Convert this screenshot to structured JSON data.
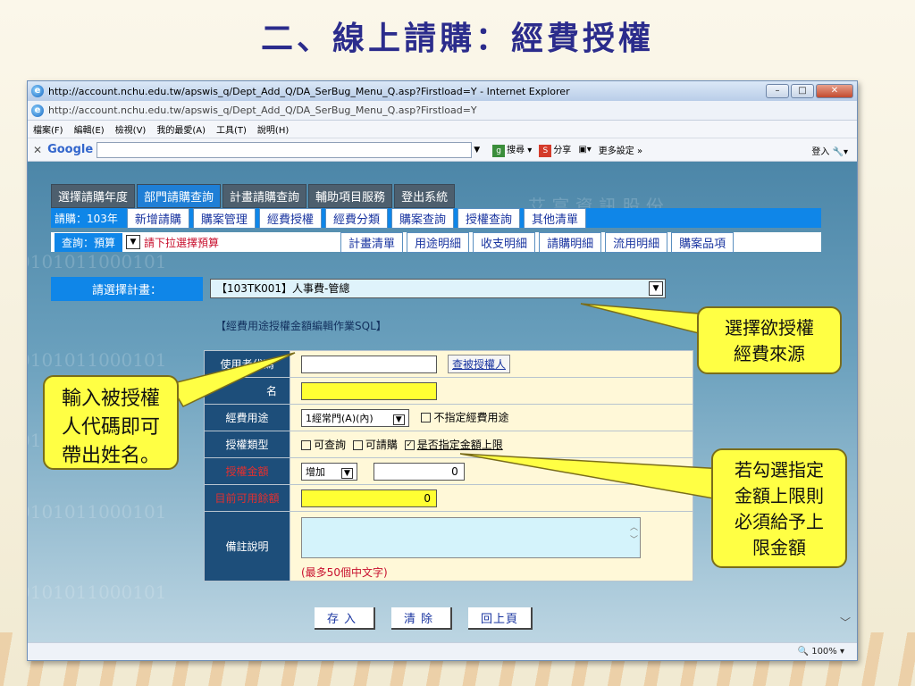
{
  "slide": {
    "title": "二、線上請購：經費授權"
  },
  "window": {
    "title": "http://account.nchu.edu.tw/apswis_q/Dept_Add_Q/DA_SerBug_Menu_Q.asp?Firstload=Y - Internet Explorer",
    "address": "http://account.nchu.edu.tw/apswis_q/Dept_Add_Q/DA_SerBug_Menu_Q.asp?Firstload=Y",
    "menu": [
      "檔案(F)",
      "編輯(E)",
      "檢視(V)",
      "我的最愛(A)",
      "工具(T)",
      "說明(H)"
    ],
    "google": {
      "logo": "Google",
      "search": "搜尋",
      "share": "分享",
      "more": "更多設定 »",
      "login": "登入"
    },
    "zoom": "100%"
  },
  "nav_tabs": [
    "選擇請購年度",
    "部門請購查詢",
    "計畫請購查詢",
    "輔助項目服務",
    "登出系統"
  ],
  "row2": {
    "label": "請購：103年",
    "buttons": [
      "新增請購",
      "購案管理",
      "經費授權",
      "經費分類",
      "購案查詢",
      "授權查詢",
      "其他清單"
    ]
  },
  "row3": {
    "label": "查詢：預算",
    "hint": "請下拉選擇預算",
    "buttons": [
      "計畫清單",
      "用途明細",
      "收支明細",
      "請購明細",
      "流用明細",
      "購案品項"
    ]
  },
  "plan": {
    "label": "請選擇計畫：",
    "value": "【103TK001】人事費-管總"
  },
  "form": {
    "legend": "【經費用途授權金額編輯作業SQL】",
    "user_code_label": "使用者代碼",
    "find_link": "查被授權人",
    "name_label": "名",
    "purpose_label": "經費用途",
    "purpose_value": "1經常門(A)(內)",
    "purpose_unspecified": "不指定經費用途",
    "auth_type_label": "授權類型",
    "auth_opt1": "可查詢",
    "auth_opt2": "可請購",
    "auth_opt3": "是否指定金額上限",
    "amount_label": "授權金額",
    "amount_mode": "增加",
    "amount_value": "0",
    "balance_label": "目前可用餘額",
    "balance_value": "0",
    "note_label": "備註說明",
    "note_hint": "(最多50個中文字)"
  },
  "buttons": {
    "save": "存入",
    "clear": "清除",
    "back": "回上頁"
  },
  "callouts": {
    "source": "選擇欲授權\n經費來源",
    "user": "輸入被授權\n人代碼即可\n帶出姓名。",
    "limit": "若勾選指定\n金額上限則\n必須給予上\n限金額"
  },
  "background_text": {
    "company": "艾 富 資 訊 股 份",
    "binary": "0101011000101"
  }
}
